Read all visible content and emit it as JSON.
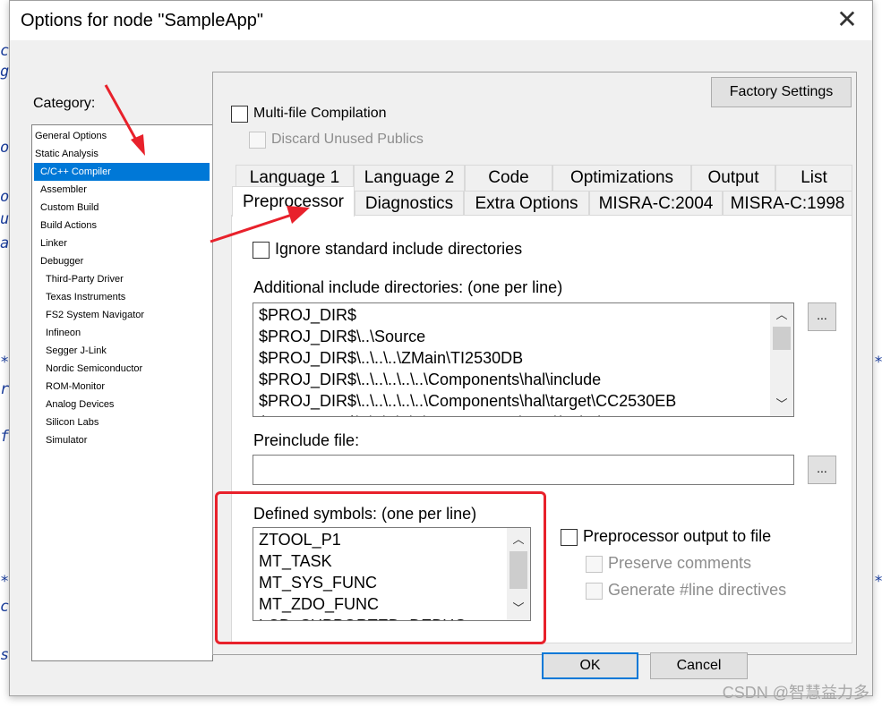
{
  "dialog": {
    "title": "Options for node \"SampleApp\"",
    "close_icon": "close-icon"
  },
  "category": {
    "label": "Category:",
    "items": [
      {
        "label": "General Options",
        "level": 0
      },
      {
        "label": "Static Analysis",
        "level": 0
      },
      {
        "label": "C/C++ Compiler",
        "level": 1,
        "selected": true
      },
      {
        "label": "Assembler",
        "level": 1
      },
      {
        "label": "Custom Build",
        "level": 1
      },
      {
        "label": "Build Actions",
        "level": 1
      },
      {
        "label": "Linker",
        "level": 1
      },
      {
        "label": "Debugger",
        "level": 1
      },
      {
        "label": "Third-Party Driver",
        "level": 2
      },
      {
        "label": "Texas Instruments",
        "level": 2
      },
      {
        "label": "FS2 System Navigator",
        "level": 2
      },
      {
        "label": "Infineon",
        "level": 2
      },
      {
        "label": "Segger J-Link",
        "level": 2
      },
      {
        "label": "Nordic Semiconductor",
        "level": 2
      },
      {
        "label": "ROM-Monitor",
        "level": 2
      },
      {
        "label": "Analog Devices",
        "level": 2
      },
      {
        "label": "Silicon Labs",
        "level": 2
      },
      {
        "label": "Simulator",
        "level": 2
      }
    ]
  },
  "factory_settings": "Factory Settings",
  "multi_file": {
    "label": "Multi-file Compilation",
    "checked": false
  },
  "discard_unused": {
    "label": "Discard Unused Publics",
    "checked": false,
    "disabled": true
  },
  "tabs_row1": [
    "Language 1",
    "Language 2",
    "Code",
    "Optimizations",
    "Output",
    "List"
  ],
  "tabs_row2": [
    "Preprocessor",
    "Diagnostics",
    "Extra Options",
    "MISRA-C:2004",
    "MISRA-C:1998"
  ],
  "active_tab": "Preprocessor",
  "preprocessor": {
    "ignore_std": {
      "label": "Ignore standard include directories",
      "checked": false
    },
    "include_dirs_label": "Additional include directories: (one per line)",
    "include_dirs": [
      "$PROJ_DIR$",
      "$PROJ_DIR$\\..\\Source",
      "$PROJ_DIR$\\..\\..\\..\\ZMain\\TI2530DB",
      "$PROJ_DIR$\\..\\..\\..\\..\\..\\Components\\hal\\include",
      "$PROJ_DIR$\\..\\..\\..\\..\\..\\Components\\hal\\target\\CC2530EB",
      "$PROJ_DIR$\\..\\..\\..\\..\\..\\Components\\mac\\include"
    ],
    "browse_label": "...",
    "preinclude_label": "Preinclude file:",
    "preinclude_value": "",
    "defined_symbols_label": "Defined symbols: (one per line)",
    "defined_symbols": [
      "ZTOOL_P1",
      "MT_TASK",
      "MT_SYS_FUNC",
      "MT_ZDO_FUNC",
      "LCD_SUPPORTED=DEBUG"
    ],
    "pp_output": {
      "label": "Preprocessor output to file",
      "checked": false
    },
    "preserve_comments": {
      "label": "Preserve comments",
      "checked": false,
      "disabled": true
    },
    "generate_line": {
      "label": "Generate #line directives",
      "checked": false,
      "disabled": true
    }
  },
  "buttons": {
    "ok": "OK",
    "cancel": "Cancel"
  },
  "watermark": "CSDN @智慧益力多",
  "colors": {
    "selection": "#0078d7",
    "annotation_red": "#e8212b"
  }
}
